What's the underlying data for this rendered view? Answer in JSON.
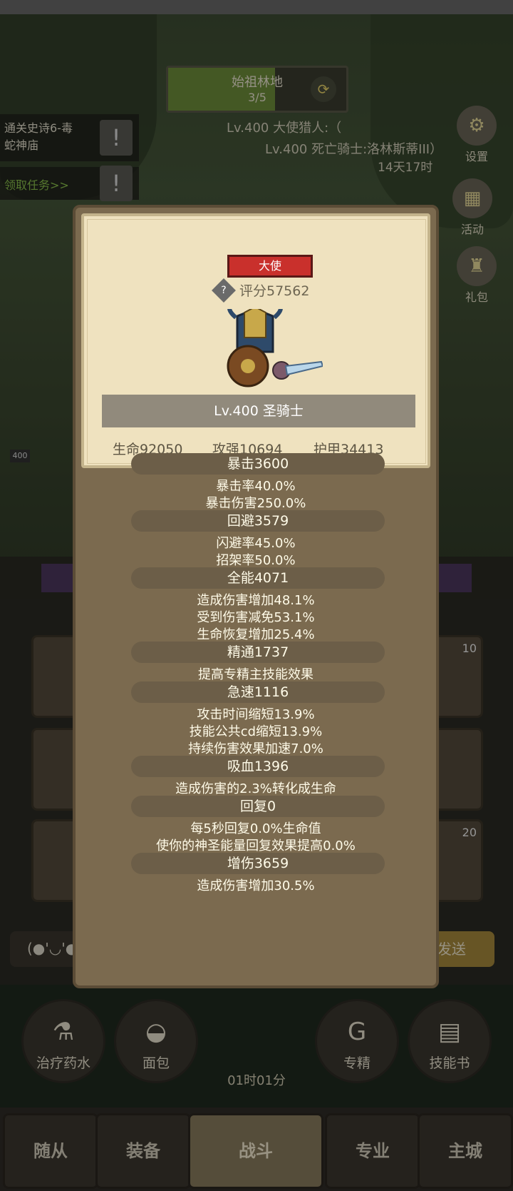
{
  "background": {
    "stage": {
      "name": "始祖林地",
      "progress": "3/5"
    },
    "quests": [
      {
        "line1": "通关史诗6-毒",
        "line2": "蛇神庙"
      }
    ],
    "claim_task": "领取任务>>",
    "news": {
      "line1": "Lv.400 大使猎人:（",
      "line2": "Lv.400 死亡骑士:洛林斯蒂III）",
      "time": "14天17时"
    },
    "side_buttons": [
      "设置",
      "活动",
      "礼包"
    ],
    "hero_level_tag": "400",
    "skill_counts": [
      "10",
      "20"
    ],
    "chat_prefix": "(●'◡'●",
    "send_label": "发送",
    "consumables": [
      "治疗药水",
      "面包",
      "专精",
      "技能书"
    ],
    "chest_timer": "01时01分",
    "nav": [
      "随从",
      "装备",
      "战斗",
      "专业",
      "主城"
    ]
  },
  "modal": {
    "role": "大使",
    "score": "评分57562",
    "name": "Lv.400 圣骑士",
    "hp": "生命92050",
    "atk": "攻强10694",
    "armor": "护甲34413",
    "sections": [
      {
        "title": "暴击3600",
        "lines": [
          "暴击率40.0%",
          "暴击伤害250.0%"
        ]
      },
      {
        "title": "回避3579",
        "lines": [
          "闪避率45.0%",
          "招架率50.0%"
        ]
      },
      {
        "title": "全能4071",
        "lines": [
          "造成伤害增加48.1%",
          "受到伤害减免53.1%",
          "生命恢复增加25.4%"
        ]
      },
      {
        "title": "精通1737",
        "lines": [
          "提高专精主技能效果"
        ]
      },
      {
        "title": "急速1116",
        "lines": [
          "攻击时间缩短13.9%",
          "技能公共cd缩短13.9%",
          "持续伤害效果加速7.0%"
        ]
      },
      {
        "title": "吸血1396",
        "lines": [
          "造成伤害的2.3%转化成生命"
        ]
      },
      {
        "title": "回复0",
        "lines": [
          "每5秒回复0.0%生命值",
          "使你的神圣能量回复效果提高0.0%"
        ]
      },
      {
        "title": "增伤3659",
        "lines": [
          "造成伤害增加30.5%"
        ]
      }
    ]
  }
}
